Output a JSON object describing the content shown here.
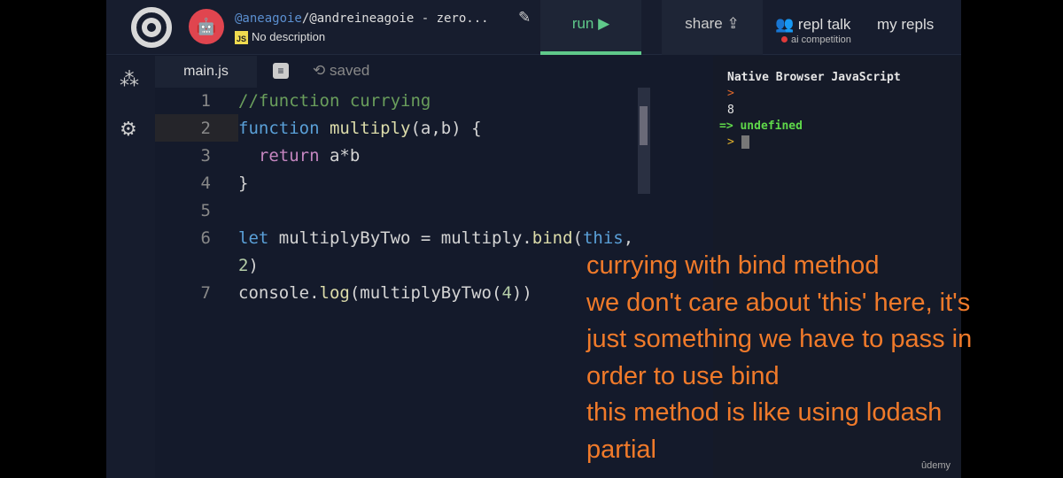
{
  "header": {
    "user_link": "@aneagoie",
    "repl_title": "/@andreineagoie - zero...",
    "language_badge": "JS",
    "description": "No description",
    "run_label": "run ▶",
    "share_label": "share",
    "repl_talk_label": "repl talk",
    "competition_label": "ai competition",
    "my_repls_label": "my repls"
  },
  "tabs": {
    "file": "main.js",
    "status": "saved"
  },
  "editor": {
    "lines": [
      {
        "num": "1",
        "html": "<span class=\"cm\">//function currying</span>"
      },
      {
        "num": "2",
        "html": "<span class=\"kw\">function</span> <span class=\"fn\">multiply</span>(a,b) {"
      },
      {
        "num": "3",
        "html": "  <span class=\"rt\">return</span> a*b"
      },
      {
        "num": "4",
        "html": "}"
      },
      {
        "num": "5",
        "html": ""
      },
      {
        "num": "6",
        "html": "<span class=\"kw\">let</span> multiplyByTwo = multiply.<span class=\"fn\">bind</span>(<span class=\"kw\">this</span>,"
      },
      {
        "num": "",
        "html": "<span class=\"nm\">2</span>)"
      },
      {
        "num": "7",
        "html": "console.<span class=\"fn\">log</span>(multiplyByTwo(<span class=\"nm\">4</span>))"
      }
    ]
  },
  "console": {
    "title": "Native Browser JavaScript",
    "prompt1": ">",
    "output": "8",
    "result": "=> undefined",
    "prompt2": ">"
  },
  "notes": [
    "currying with bind method",
    "we don't care about 'this' here, it's",
    "just something we have to pass in",
    "order to use bind",
    "this method is like using lodash",
    "partial"
  ],
  "watermark": "ûdemy",
  "colors": {
    "accent": "#5fc98a",
    "notes": "#f07a2a",
    "background": "#141a2b"
  }
}
